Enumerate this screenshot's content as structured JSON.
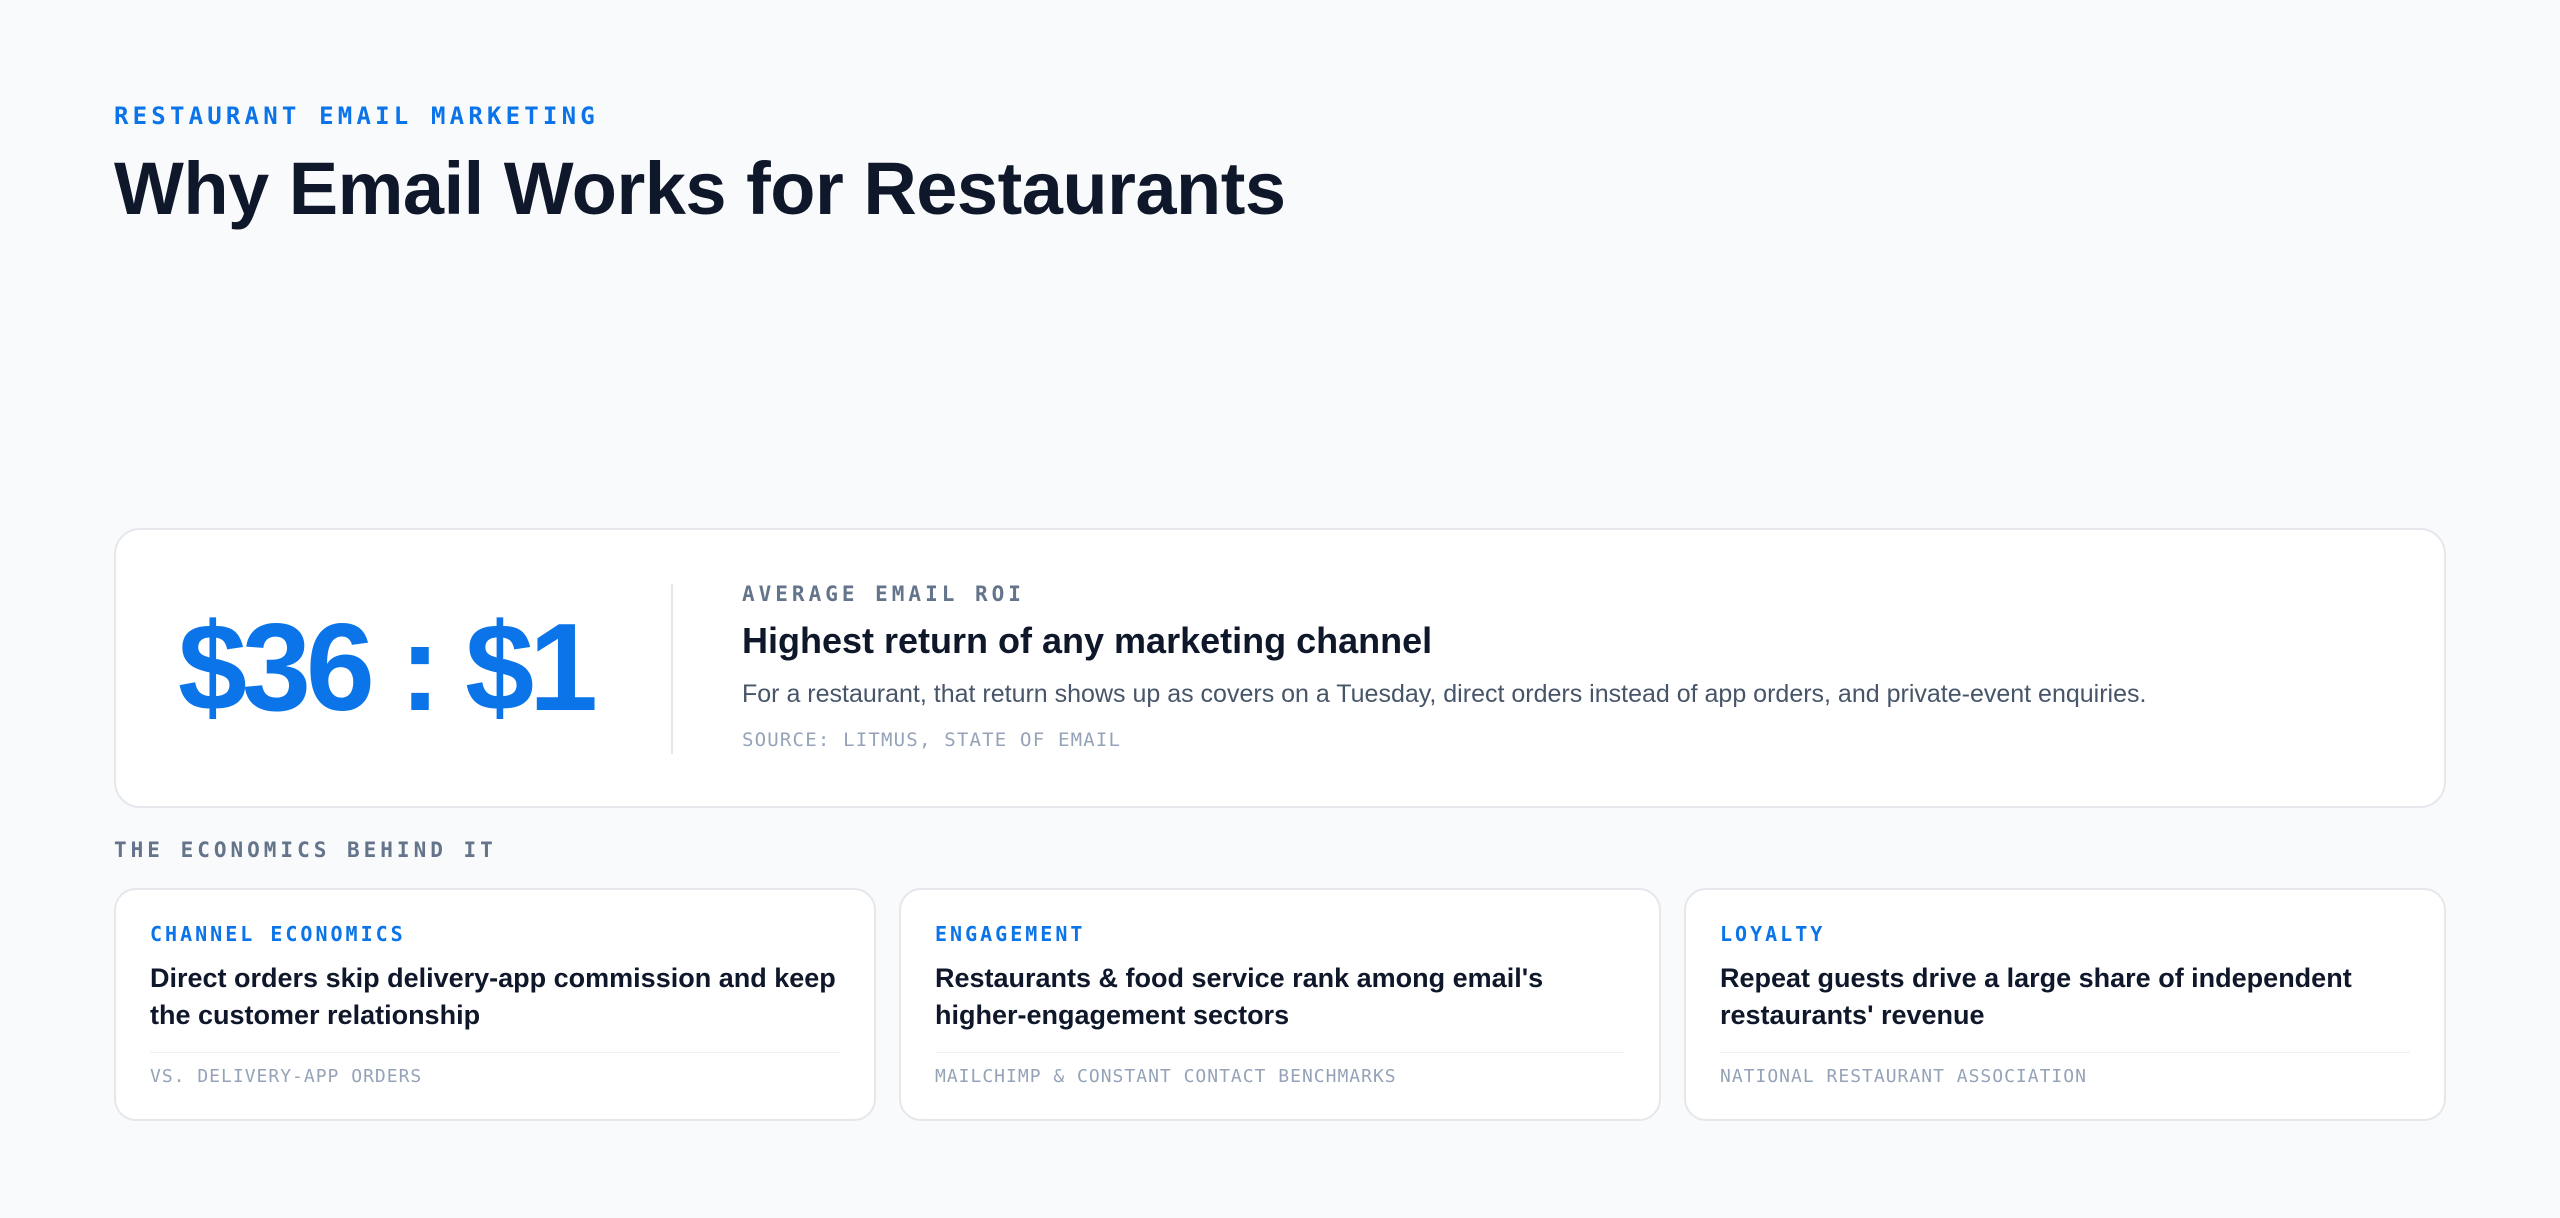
{
  "header": {
    "eyebrow": "RESTAURANT EMAIL MARKETING",
    "title": "Why Email Works for Restaurants"
  },
  "roi": {
    "figure": "$36 : $1",
    "label": "AVERAGE EMAIL ROI",
    "heading": "Highest return of any marketing channel",
    "description": "For a restaurant, that return shows up as covers on a Tuesday, direct orders instead of app orders, and private-event enquiries.",
    "source": "SOURCE: LITMUS, STATE OF EMAIL"
  },
  "economics": {
    "section_label": "THE ECONOMICS BEHIND IT",
    "cards": [
      {
        "tag": "CHANNEL ECONOMICS",
        "title": "Direct orders skip delivery-app commission and keep the customer relationship",
        "source": "VS. DELIVERY-APP ORDERS"
      },
      {
        "tag": "ENGAGEMENT",
        "title": "Restaurants & food service rank among email's higher-engagement sectors",
        "source": "MAILCHIMP & CONSTANT CONTACT BENCHMARKS"
      },
      {
        "tag": "LOYALTY",
        "title": "Repeat guests drive a large share of independent restaurants' revenue",
        "source": "NATIONAL RESTAURANT ASSOCIATION"
      }
    ]
  },
  "colors": {
    "accent": "#0b74e8",
    "heading": "#0f172a",
    "muted": "#64748b",
    "background": "#f9fafb"
  }
}
